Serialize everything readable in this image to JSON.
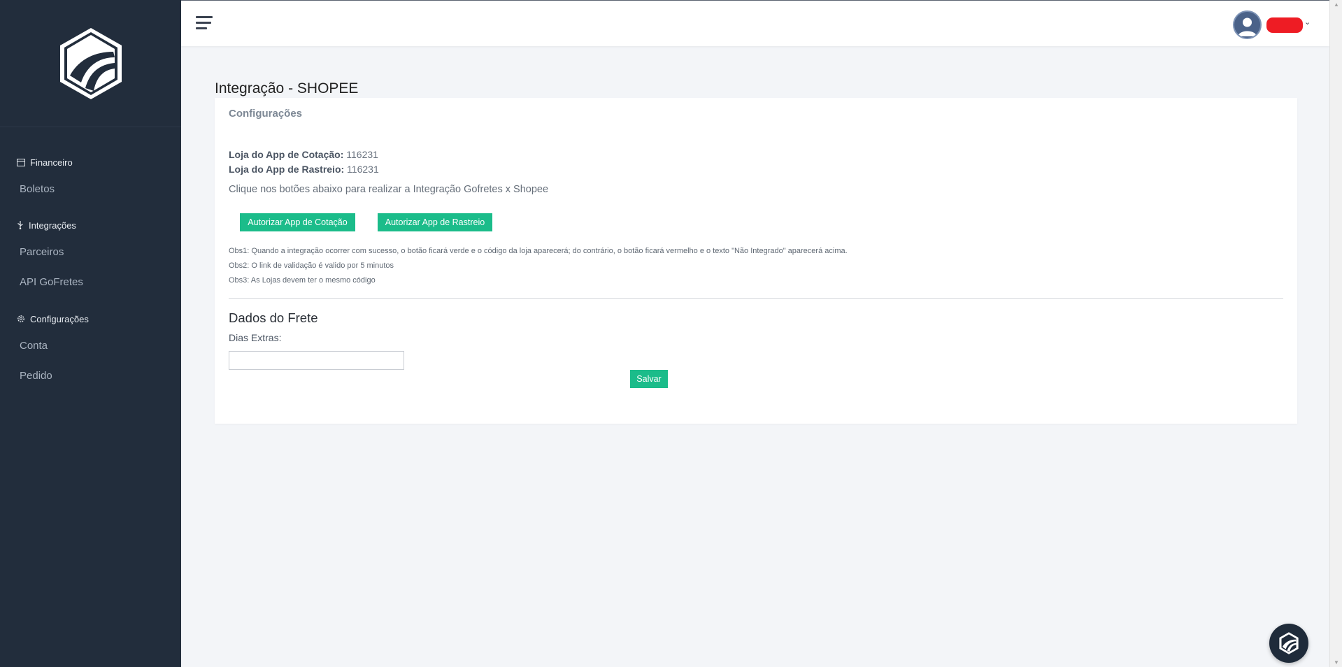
{
  "sidebar": {
    "sections": [
      {
        "label": "Financeiro",
        "icon": "wallet-icon",
        "items": [
          "Boletos"
        ]
      },
      {
        "label": "Integrações",
        "icon": "usb-icon",
        "items": [
          "Parceiros",
          "API GoFretes"
        ]
      },
      {
        "label": "Configurações",
        "icon": "gear-icon",
        "items": [
          "Conta",
          "Pedido"
        ]
      }
    ]
  },
  "topbar": {
    "menu_icon": "hamburger-icon",
    "avatar_icon": "user-avatar-icon",
    "caret_icon": "chevron-down-icon"
  },
  "page": {
    "title": "Integração - SHOPEE",
    "card_header": "Configurações",
    "cotacao_label": "Loja do App de Cotação:",
    "cotacao_value": "116231",
    "rastreio_label": "Loja do App de Rastreio:",
    "rastreio_value": "116231",
    "instruction": "Clique nos botões abaixo para realizar a Integração Gofretes x Shopee",
    "btn_cotacao": "Autorizar App de Cotação",
    "btn_rastreio": "Autorizar App de Rastreio",
    "obs1": "Obs1: Quando a integração ocorrer com sucesso, o botão ficará verde e o código da loja aparecerá; do contrário, o botão ficará vermelho e o texto \"Não Integrado\" aparecerá acima.",
    "obs2": "Obs2: O link de validação é valido por 5 minutos",
    "obs3": "Obs3: As Lojas devem ter o mesmo código",
    "frete_title": "Dados do Frete",
    "dias_label": "Dias Extras:",
    "dias_value": "",
    "save_label": "Salvar"
  },
  "colors": {
    "sidebar_bg": "#222d3c",
    "accent": "#1bbc8a",
    "redaction": "#ee1c24"
  }
}
